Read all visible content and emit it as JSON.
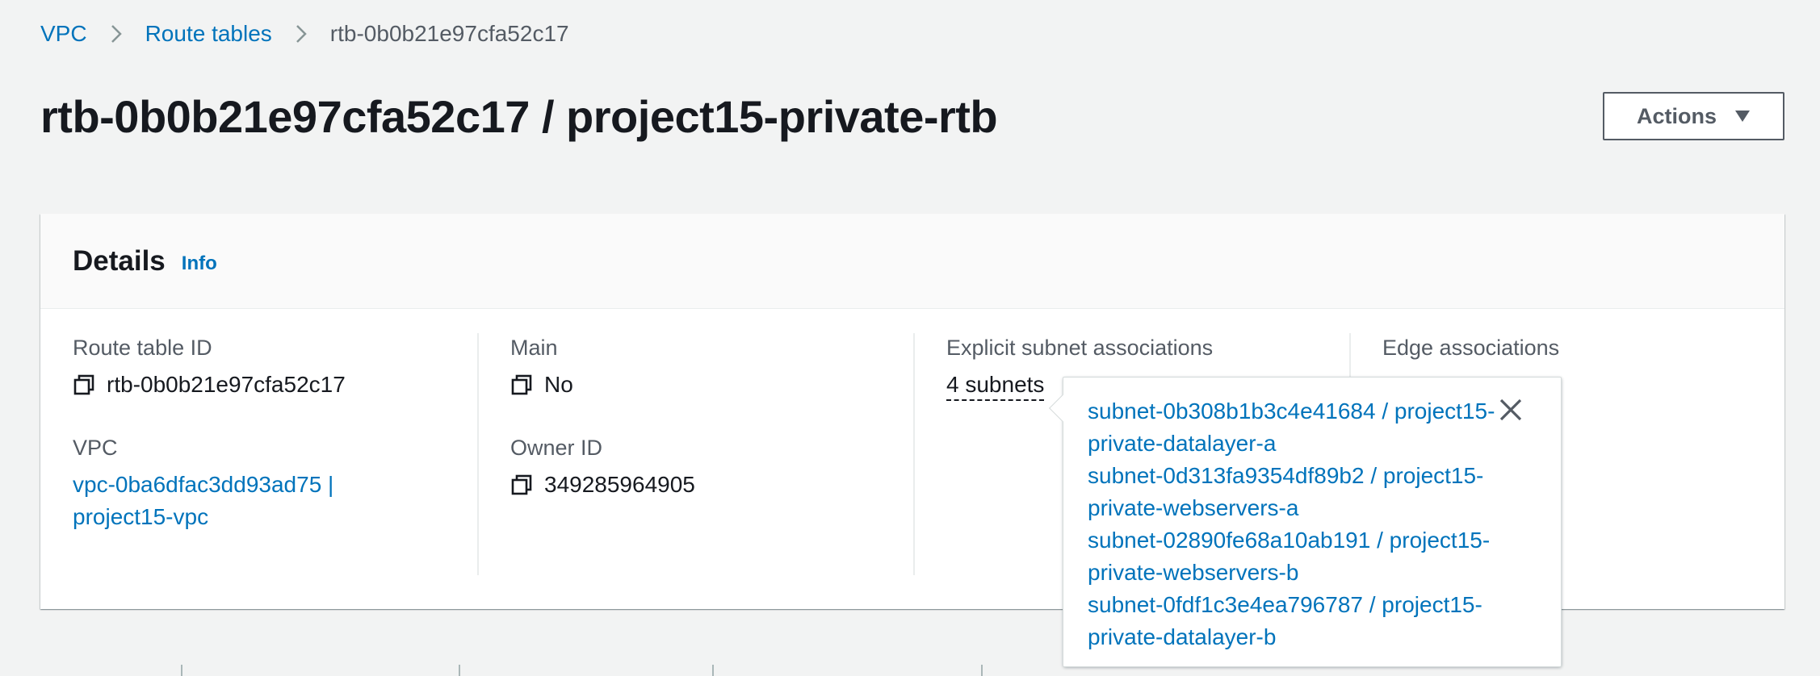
{
  "breadcrumb": {
    "items": [
      "VPC",
      "Route tables",
      "rtb-0b0b21e97cfa52c17"
    ]
  },
  "header": {
    "title": "rtb-0b0b21e97cfa52c17 / project15-private-rtb",
    "actions_label": "Actions"
  },
  "details": {
    "title": "Details",
    "info_label": "Info",
    "route_table_id_label": "Route table ID",
    "route_table_id_value": "rtb-0b0b21e97cfa52c17",
    "vpc_label": "VPC",
    "vpc_value": "vpc-0ba6dfac3dd93ad75 | project15-vpc",
    "main_label": "Main",
    "main_value": "No",
    "owner_id_label": "Owner ID",
    "owner_id_value": "349285964905",
    "explicit_subnet_label": "Explicit subnet associations",
    "explicit_subnet_value": "4 subnets",
    "edge_associations_label": "Edge associations"
  },
  "popover": {
    "subnets": [
      "subnet-0b308b1b3c4e41684 / project15-private-datalayer-a",
      "subnet-0d313fa9354df89b2 / project15-private-webservers-a",
      "subnet-02890fe68a10ab191 / project15-private-webservers-b",
      "subnet-0fdf1c3e4ea796787 / project15-private-datalayer-b"
    ]
  },
  "colors": {
    "link": "#0073bb",
    "text": "#16191f",
    "muted": "#545b64",
    "background": "#f2f3f3"
  }
}
